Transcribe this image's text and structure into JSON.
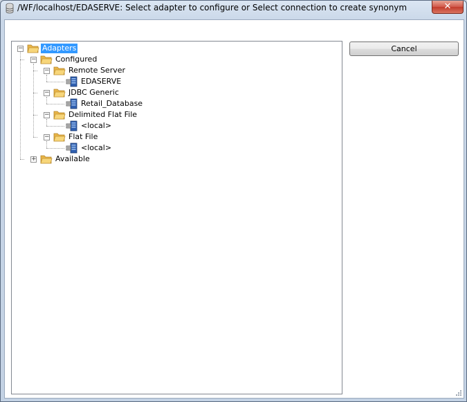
{
  "window": {
    "title": "/WF/localhost/EDASERVE: Select adapter to configure or Select connection to create synonym",
    "close_glyph": "✕"
  },
  "buttons": {
    "cancel_label": "Cancel"
  },
  "tree": {
    "root": "Adapters",
    "configured": "Configured",
    "remote_server": "Remote Server",
    "edaserve": "EDASERVE",
    "jdbc_generic": "JDBC Generic",
    "retail_database": "Retail_Database",
    "delimited_flat_file": "Delimited Flat File",
    "delimited_local": "<local>",
    "flat_file": "Flat File",
    "flat_local": "<local>",
    "available": "Available",
    "minus_glyph": "−",
    "plus_glyph": "+"
  },
  "icons": {
    "folder": "folder-open-icon",
    "connection": "server-connection-icon",
    "app": "database-app-icon"
  },
  "colors": {
    "selection": "#3399ff",
    "folder": "#f2c35b",
    "connection_blue": "#2f5fb0"
  }
}
